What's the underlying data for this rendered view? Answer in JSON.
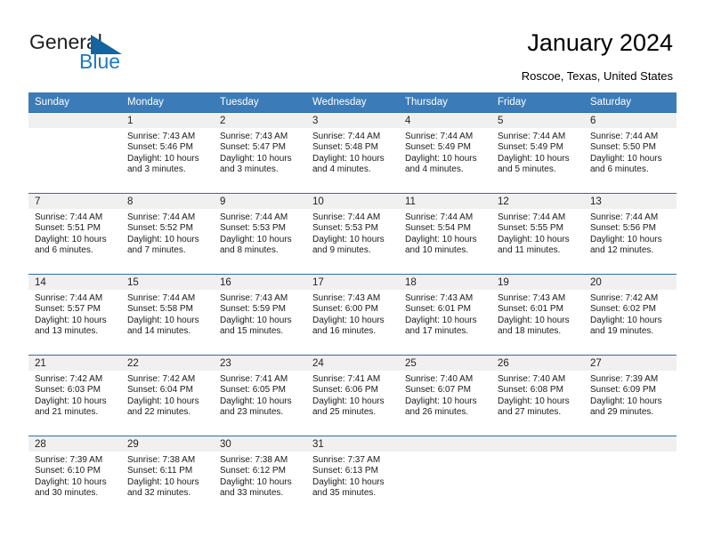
{
  "brand": {
    "name_part1": "General",
    "name_part2": "Blue",
    "triangle_color": "#1464a0",
    "blue_text_color": "#1d7ac4"
  },
  "header": {
    "title": "January 2024",
    "location": "Roscoe, Texas, United States",
    "header_bg_color": "#3b7cb8",
    "row_divider_color": "#2e6da4",
    "daynum_band_color": "#f0f0f0"
  },
  "weekdays": [
    "Sunday",
    "Monday",
    "Tuesday",
    "Wednesday",
    "Thursday",
    "Friday",
    "Saturday"
  ],
  "weeks": [
    [
      {
        "day": "",
        "lines": []
      },
      {
        "day": "1",
        "lines": [
          "Sunrise: 7:43 AM",
          "Sunset: 5:46 PM",
          "Daylight: 10 hours",
          "and 3 minutes."
        ]
      },
      {
        "day": "2",
        "lines": [
          "Sunrise: 7:43 AM",
          "Sunset: 5:47 PM",
          "Daylight: 10 hours",
          "and 3 minutes."
        ]
      },
      {
        "day": "3",
        "lines": [
          "Sunrise: 7:44 AM",
          "Sunset: 5:48 PM",
          "Daylight: 10 hours",
          "and 4 minutes."
        ]
      },
      {
        "day": "4",
        "lines": [
          "Sunrise: 7:44 AM",
          "Sunset: 5:49 PM",
          "Daylight: 10 hours",
          "and 4 minutes."
        ]
      },
      {
        "day": "5",
        "lines": [
          "Sunrise: 7:44 AM",
          "Sunset: 5:49 PM",
          "Daylight: 10 hours",
          "and 5 minutes."
        ]
      },
      {
        "day": "6",
        "lines": [
          "Sunrise: 7:44 AM",
          "Sunset: 5:50 PM",
          "Daylight: 10 hours",
          "and 6 minutes."
        ]
      }
    ],
    [
      {
        "day": "7",
        "lines": [
          "Sunrise: 7:44 AM",
          "Sunset: 5:51 PM",
          "Daylight: 10 hours",
          "and 6 minutes."
        ]
      },
      {
        "day": "8",
        "lines": [
          "Sunrise: 7:44 AM",
          "Sunset: 5:52 PM",
          "Daylight: 10 hours",
          "and 7 minutes."
        ]
      },
      {
        "day": "9",
        "lines": [
          "Sunrise: 7:44 AM",
          "Sunset: 5:53 PM",
          "Daylight: 10 hours",
          "and 8 minutes."
        ]
      },
      {
        "day": "10",
        "lines": [
          "Sunrise: 7:44 AM",
          "Sunset: 5:53 PM",
          "Daylight: 10 hours",
          "and 9 minutes."
        ]
      },
      {
        "day": "11",
        "lines": [
          "Sunrise: 7:44 AM",
          "Sunset: 5:54 PM",
          "Daylight: 10 hours",
          "and 10 minutes."
        ]
      },
      {
        "day": "12",
        "lines": [
          "Sunrise: 7:44 AM",
          "Sunset: 5:55 PM",
          "Daylight: 10 hours",
          "and 11 minutes."
        ]
      },
      {
        "day": "13",
        "lines": [
          "Sunrise: 7:44 AM",
          "Sunset: 5:56 PM",
          "Daylight: 10 hours",
          "and 12 minutes."
        ]
      }
    ],
    [
      {
        "day": "14",
        "lines": [
          "Sunrise: 7:44 AM",
          "Sunset: 5:57 PM",
          "Daylight: 10 hours",
          "and 13 minutes."
        ]
      },
      {
        "day": "15",
        "lines": [
          "Sunrise: 7:44 AM",
          "Sunset: 5:58 PM",
          "Daylight: 10 hours",
          "and 14 minutes."
        ]
      },
      {
        "day": "16",
        "lines": [
          "Sunrise: 7:43 AM",
          "Sunset: 5:59 PM",
          "Daylight: 10 hours",
          "and 15 minutes."
        ]
      },
      {
        "day": "17",
        "lines": [
          "Sunrise: 7:43 AM",
          "Sunset: 6:00 PM",
          "Daylight: 10 hours",
          "and 16 minutes."
        ]
      },
      {
        "day": "18",
        "lines": [
          "Sunrise: 7:43 AM",
          "Sunset: 6:01 PM",
          "Daylight: 10 hours",
          "and 17 minutes."
        ]
      },
      {
        "day": "19",
        "lines": [
          "Sunrise: 7:43 AM",
          "Sunset: 6:01 PM",
          "Daylight: 10 hours",
          "and 18 minutes."
        ]
      },
      {
        "day": "20",
        "lines": [
          "Sunrise: 7:42 AM",
          "Sunset: 6:02 PM",
          "Daylight: 10 hours",
          "and 19 minutes."
        ]
      }
    ],
    [
      {
        "day": "21",
        "lines": [
          "Sunrise: 7:42 AM",
          "Sunset: 6:03 PM",
          "Daylight: 10 hours",
          "and 21 minutes."
        ]
      },
      {
        "day": "22",
        "lines": [
          "Sunrise: 7:42 AM",
          "Sunset: 6:04 PM",
          "Daylight: 10 hours",
          "and 22 minutes."
        ]
      },
      {
        "day": "23",
        "lines": [
          "Sunrise: 7:41 AM",
          "Sunset: 6:05 PM",
          "Daylight: 10 hours",
          "and 23 minutes."
        ]
      },
      {
        "day": "24",
        "lines": [
          "Sunrise: 7:41 AM",
          "Sunset: 6:06 PM",
          "Daylight: 10 hours",
          "and 25 minutes."
        ]
      },
      {
        "day": "25",
        "lines": [
          "Sunrise: 7:40 AM",
          "Sunset: 6:07 PM",
          "Daylight: 10 hours",
          "and 26 minutes."
        ]
      },
      {
        "day": "26",
        "lines": [
          "Sunrise: 7:40 AM",
          "Sunset: 6:08 PM",
          "Daylight: 10 hours",
          "and 27 minutes."
        ]
      },
      {
        "day": "27",
        "lines": [
          "Sunrise: 7:39 AM",
          "Sunset: 6:09 PM",
          "Daylight: 10 hours",
          "and 29 minutes."
        ]
      }
    ],
    [
      {
        "day": "28",
        "lines": [
          "Sunrise: 7:39 AM",
          "Sunset: 6:10 PM",
          "Daylight: 10 hours",
          "and 30 minutes."
        ]
      },
      {
        "day": "29",
        "lines": [
          "Sunrise: 7:38 AM",
          "Sunset: 6:11 PM",
          "Daylight: 10 hours",
          "and 32 minutes."
        ]
      },
      {
        "day": "30",
        "lines": [
          "Sunrise: 7:38 AM",
          "Sunset: 6:12 PM",
          "Daylight: 10 hours",
          "and 33 minutes."
        ]
      },
      {
        "day": "31",
        "lines": [
          "Sunrise: 7:37 AM",
          "Sunset: 6:13 PM",
          "Daylight: 10 hours",
          "and 35 minutes."
        ]
      },
      {
        "day": "",
        "lines": []
      },
      {
        "day": "",
        "lines": []
      },
      {
        "day": "",
        "lines": []
      }
    ]
  ]
}
